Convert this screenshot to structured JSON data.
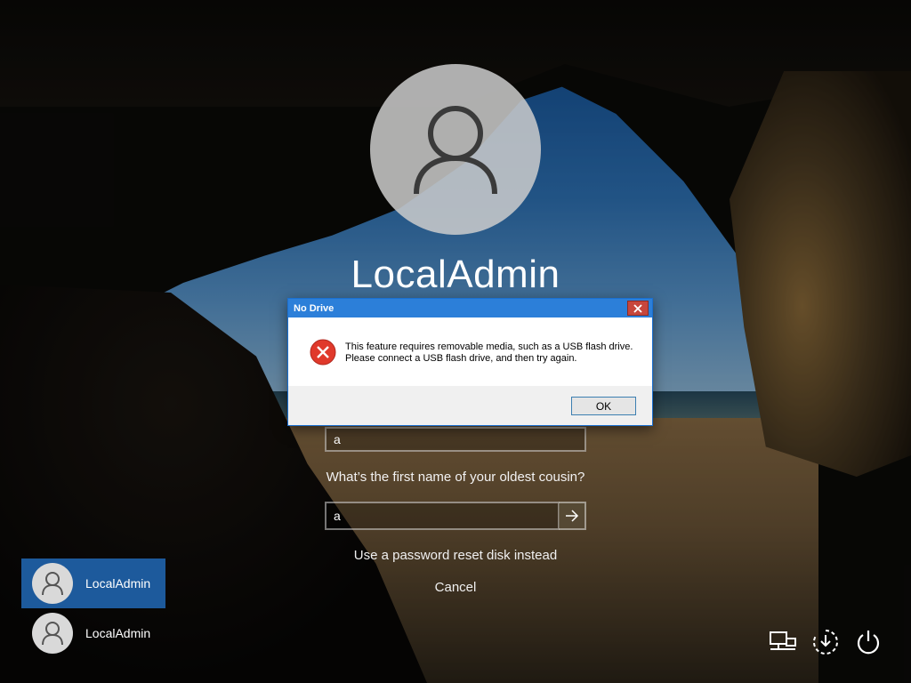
{
  "user": {
    "name": "LocalAdmin"
  },
  "security": {
    "answer1_value": "a",
    "question2": "What’s the first name of your oldest cousin?",
    "answer2_value": "a"
  },
  "links": {
    "reset_disk": "Use a password reset disk instead",
    "cancel": "Cancel"
  },
  "user_tiles": [
    {
      "label": "LocalAdmin",
      "selected": true
    },
    {
      "label": "LocalAdmin",
      "selected": false
    }
  ],
  "system_icons": [
    "network-icon",
    "ease-of-access-icon",
    "power-icon"
  ],
  "dialog": {
    "title": "No Drive",
    "message_line1": "This feature requires removable media, such as a USB flash drive.",
    "message_line2": "Please connect a USB flash drive, and then try again.",
    "ok_label": "OK",
    "icon": "error-icon"
  },
  "colors": {
    "dialog_titlebar": "#2c7fd9",
    "selected_tile": "#1d5a9c",
    "close_button": "#c7463c",
    "error_red": "#e0392b"
  }
}
